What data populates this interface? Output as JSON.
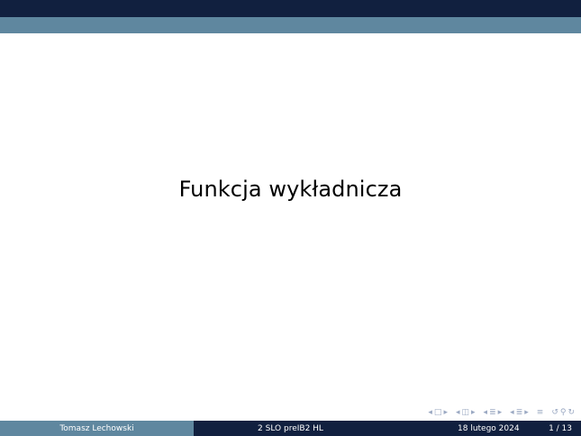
{
  "slide": {
    "title": "Funkcja wykładnicza"
  },
  "footer": {
    "author": "Tomasz Lechowski",
    "course": "2 SLO preIB2 HL",
    "date": "18 lutego 2024",
    "page": "1 / 13"
  },
  "navigation": {
    "frame_prev": "◂",
    "frame_icon": "□",
    "frame_next": "▸",
    "subsection_prev": "◂",
    "subsection_icon": "◫",
    "subsection_next": "▸",
    "section_prev": "◂",
    "section_icon": "≣",
    "section_next": "▸",
    "doc_prev": "◂",
    "doc_icon": "≣",
    "doc_next": "▸",
    "appendix_icon": "≡",
    "search_back": "↺",
    "search_icon": "⚲",
    "search_forward": "↻"
  },
  "colors": {
    "primary_dark": "#11203f",
    "secondary": "#5f879f",
    "nav_symbol": "#9aa8c2"
  }
}
